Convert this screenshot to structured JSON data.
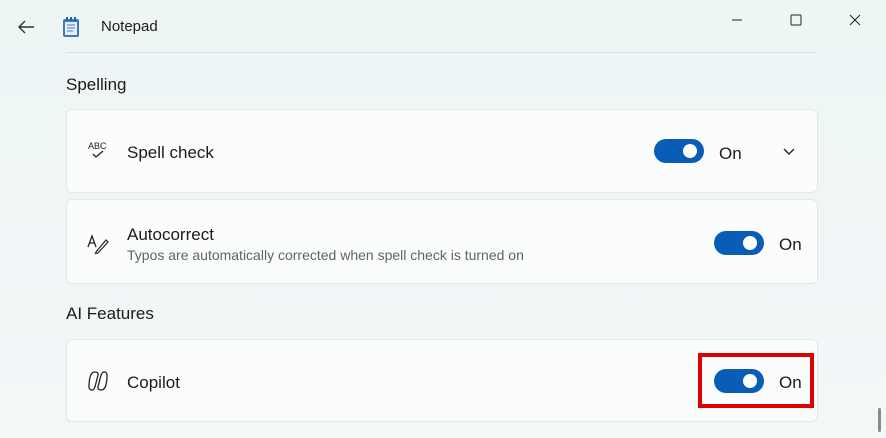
{
  "window": {
    "title": "Notepad",
    "back_icon": "arrow-left-icon",
    "app_icon": "notepad-icon",
    "minimize_icon": "minimize-icon",
    "maximize_icon": "maximize-icon",
    "close_icon": "close-icon"
  },
  "sections": {
    "spelling": {
      "title": "Spelling",
      "spell_check": {
        "label": "Spell check",
        "state": "On",
        "icon": "spell-check-icon",
        "expand_icon": "chevron-down-icon"
      },
      "autocorrect": {
        "label": "Autocorrect",
        "description": "Typos are automatically corrected when spell check is turned on",
        "state": "On",
        "icon": "autocorrect-icon"
      }
    },
    "ai_features": {
      "title": "AI Features",
      "copilot": {
        "label": "Copilot",
        "state": "On",
        "icon": "copilot-icon"
      }
    }
  },
  "colors": {
    "accent": "#0a5db5",
    "highlight": "#e00000",
    "background": "#eef5f5",
    "card": "#fbfdfd"
  }
}
